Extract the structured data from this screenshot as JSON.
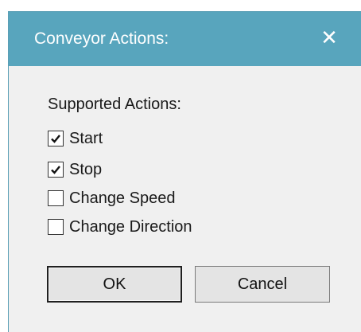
{
  "window": {
    "title": "Conveyor Actions:",
    "close_label": "✕"
  },
  "group": {
    "label": "Supported Actions:"
  },
  "actions": [
    {
      "label": "Start",
      "checked": true
    },
    {
      "label": "Stop",
      "checked": true
    },
    {
      "label": "Change Speed",
      "checked": false
    },
    {
      "label": "Change Direction",
      "checked": false
    }
  ],
  "buttons": {
    "ok_label": "OK",
    "cancel_label": "Cancel"
  },
  "colors": {
    "titlebar": "#58a5bd",
    "dialog_bg": "#f0f0f0"
  }
}
